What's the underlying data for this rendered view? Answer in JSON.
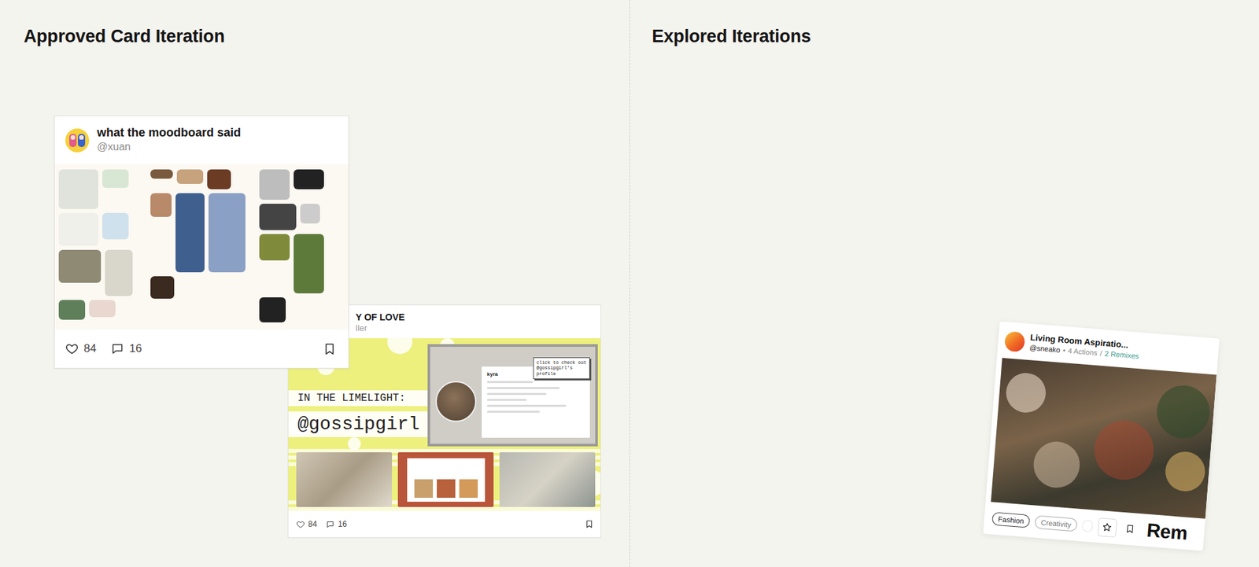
{
  "canvas": {
    "sections": [
      {
        "title": "Approved Card Iteration"
      },
      {
        "title": "Explored Iterations"
      }
    ]
  },
  "approved_cards": [
    {
      "title": "what the moodboard said",
      "handle": "@xuan",
      "likes": "84",
      "comments": "16"
    },
    {
      "title": "Y OF LOVE",
      "handle": "ller",
      "likes": "84",
      "comments": "16",
      "graphic": {
        "kicker": "IN THE LIMELIGHT:",
        "headline": "@gossipgirl",
        "profile_name": "kyra",
        "callout": "click to check out @gossipgirl's profile"
      }
    }
  ],
  "explored_cards": [
    {
      "title": "Living Room Aspiratio...",
      "handle": "@sneako",
      "separator": "•",
      "actions": "4 Actions",
      "divider": "/",
      "remixes": "2 Remixes",
      "tags": [
        "Fashion",
        "Creativity"
      ],
      "button": "Rem"
    }
  ]
}
